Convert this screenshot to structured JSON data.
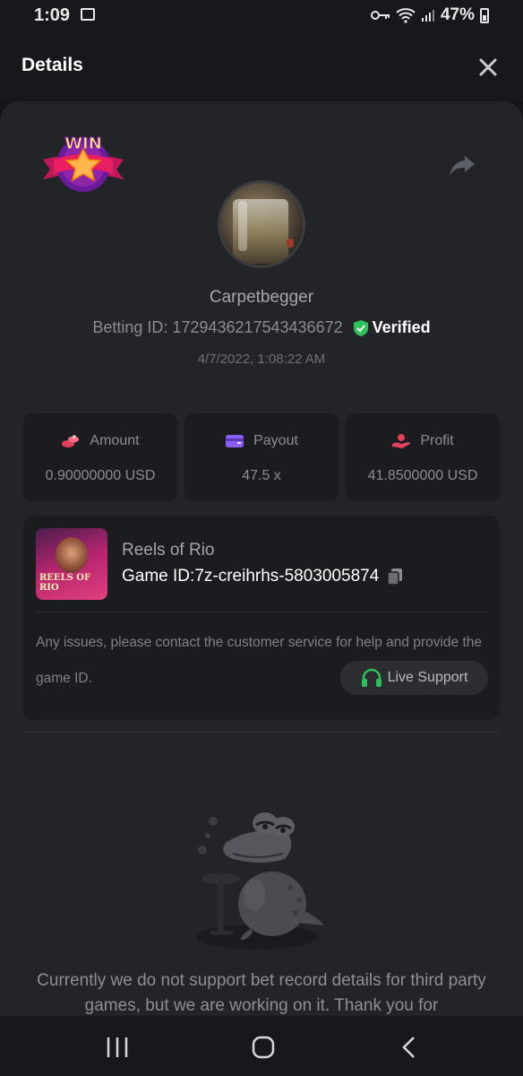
{
  "status_bar": {
    "time": "1:09",
    "battery": "47%"
  },
  "header": {
    "title": "Details"
  },
  "bet": {
    "username": "Carpetbegger",
    "betting_id_label": "Betting ID:",
    "betting_id": "1729436217543436672",
    "verified_label": "Verified",
    "datetime": "4/7/2022, 1:08:22 AM",
    "badge_text": "WIN"
  },
  "stats": [
    {
      "label": "Amount",
      "value": "0.90000000 USD",
      "icon": "coins-icon",
      "color": "#e0415a"
    },
    {
      "label": "Payout",
      "value": "47.5 x",
      "icon": "wallet-icon",
      "color": "#8b5cf6"
    },
    {
      "label": "Profit",
      "value": "41.8500000 USD",
      "icon": "hand-money-icon",
      "color": "#e0415a"
    }
  ],
  "game": {
    "name": "Reels of Rio",
    "id_label": "Game ID:",
    "id": "7z-creihrhs-5803005874",
    "thumb_text": "REELS OF RIO",
    "help_text": "Any issues, please contact the customer service for help and provide the game ID.",
    "support_label": "Live Support"
  },
  "notice": "Currently we do not support bet record details for third party games, but we are working on it. Thank you for",
  "colors": {
    "accent_green": "#2fbf5b",
    "panel": "#232427",
    "card": "#1b1c1f"
  }
}
